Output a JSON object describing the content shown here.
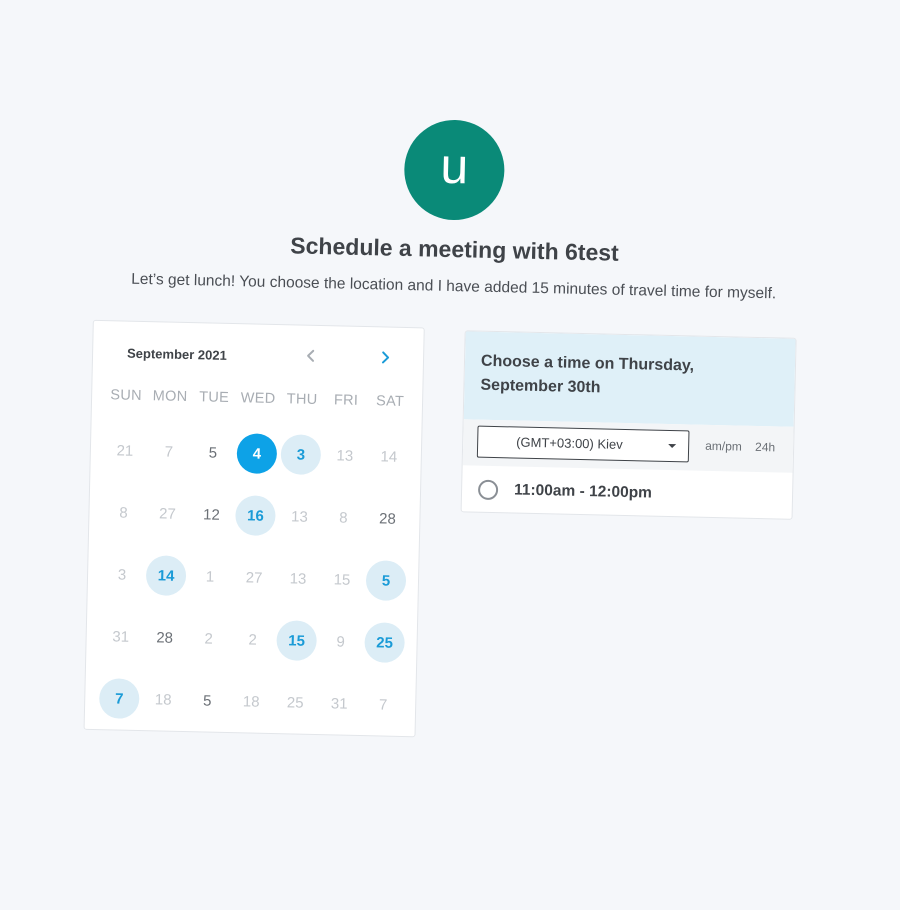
{
  "avatar": {
    "initial": "u",
    "color": "#0a8a78"
  },
  "header": {
    "title": "Schedule a meeting with 6test",
    "subtitle": "Let’s get lunch! You choose the location and I have added 15 minutes of travel time for myself."
  },
  "calendar": {
    "month_label": "September 2021",
    "prev_icon": "chevron-left-icon",
    "next_icon": "chevron-right-icon",
    "weekdays": [
      "SUN",
      "MON",
      "TUE",
      "WED",
      "THU",
      "FRI",
      "SAT"
    ],
    "days": [
      {
        "label": "21",
        "state": "muted"
      },
      {
        "label": "7",
        "state": "muted"
      },
      {
        "label": "5",
        "state": "dark"
      },
      {
        "label": "4",
        "state": "selected"
      },
      {
        "label": "3",
        "state": "avail"
      },
      {
        "label": "13",
        "state": "muted"
      },
      {
        "label": "14",
        "state": "muted"
      },
      {
        "label": "8",
        "state": "muted"
      },
      {
        "label": "27",
        "state": "muted"
      },
      {
        "label": "12",
        "state": "dark"
      },
      {
        "label": "16",
        "state": "avail"
      },
      {
        "label": "13",
        "state": "muted"
      },
      {
        "label": "8",
        "state": "muted"
      },
      {
        "label": "28",
        "state": "dark"
      },
      {
        "label": "3",
        "state": "muted"
      },
      {
        "label": "14",
        "state": "avail"
      },
      {
        "label": "1",
        "state": "muted"
      },
      {
        "label": "27",
        "state": "muted"
      },
      {
        "label": "13",
        "state": "muted"
      },
      {
        "label": "15",
        "state": "muted"
      },
      {
        "label": "5",
        "state": "avail"
      },
      {
        "label": "31",
        "state": "muted"
      },
      {
        "label": "28",
        "state": "dark"
      },
      {
        "label": "2",
        "state": "muted"
      },
      {
        "label": "2",
        "state": "muted"
      },
      {
        "label": "15",
        "state": "avail"
      },
      {
        "label": "9",
        "state": "muted"
      },
      {
        "label": "25",
        "state": "avail"
      },
      {
        "label": "7",
        "state": "avail"
      },
      {
        "label": "18",
        "state": "muted"
      },
      {
        "label": "5",
        "state": "dark"
      },
      {
        "label": "18",
        "state": "muted"
      },
      {
        "label": "25",
        "state": "muted"
      },
      {
        "label": "31",
        "state": "muted"
      },
      {
        "label": "7",
        "state": "muted"
      }
    ],
    "colors": {
      "selected": "#0da2e7",
      "available_bg": "#dcedf6",
      "available_text": "#1a9bd7"
    }
  },
  "time_panel": {
    "heading": "Choose a time on Thursday, September 30th",
    "timezone_value": "(GMT+03:00) Kiev",
    "format_ampm": "am/pm",
    "format_24h": "24h",
    "slots": [
      {
        "label": "11:00am - 12:00pm",
        "selected": false
      }
    ]
  }
}
